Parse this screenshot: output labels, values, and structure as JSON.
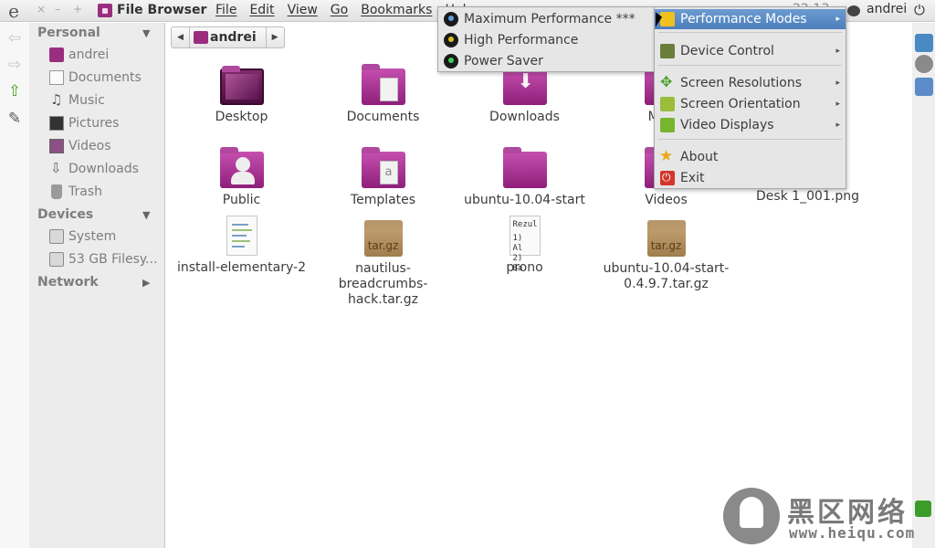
{
  "panel": {
    "logo": "e",
    "close": "×",
    "minimize": "–",
    "maximize": "+",
    "app_title": "File Browser",
    "menus": [
      "File",
      "Edit",
      "View",
      "Go",
      "Bookmarks",
      "Help"
    ],
    "user": "andrei",
    "power": "⏻",
    "clock": "22:13"
  },
  "toolstrip": {
    "back": "⇦",
    "forward": "⇨",
    "up": "⇧",
    "edit": "✎"
  },
  "sidebar": {
    "personal_heading": "Personal",
    "personal_items": [
      "andrei",
      "Documents",
      "Music",
      "Pictures",
      "Videos",
      "Downloads",
      "Trash"
    ],
    "devices_heading": "Devices",
    "device_items": [
      "System",
      "53 GB Filesy..."
    ],
    "network_heading": "Network",
    "expand_arrow": "▼",
    "collapsed_arrow": "▶"
  },
  "breadcrumb": {
    "back": "◀",
    "current": "andrei",
    "forward": "▶"
  },
  "files": [
    {
      "label": "Desktop"
    },
    {
      "label": "Documents"
    },
    {
      "label": "Downloads"
    },
    {
      "label": "Music"
    },
    {
      "label": "Public"
    },
    {
      "label": "Templates"
    },
    {
      "label": "ubuntu-10.04-start"
    },
    {
      "label": "Videos"
    },
    {
      "label": "Desk 1_001.png"
    },
    {
      "label": "install-elementary-2"
    },
    {
      "label": "nautilus-breadcrumbs-hack.tar.gz"
    },
    {
      "label": "prono"
    },
    {
      "label": "ubuntu-10.04-start-0.4.9.7.tar.gz"
    }
  ],
  "prono_preview": [
    "Rezul",
    "",
    "1) Al",
    "2) Ba"
  ],
  "tar_label": "tar.gz",
  "perf_menu": {
    "items": [
      "Maximum Performance ***",
      "High Performance",
      "Power Saver"
    ]
  },
  "main_menu": {
    "items": [
      "Performance Modes",
      "Device Control",
      "Screen Resolutions",
      "Screen Orientation",
      "Video Displays",
      "About",
      "Exit"
    ],
    "submenu_arrow": "▸"
  },
  "watermark": {
    "text": "黑区网络",
    "url": "www.heiqu.com"
  }
}
